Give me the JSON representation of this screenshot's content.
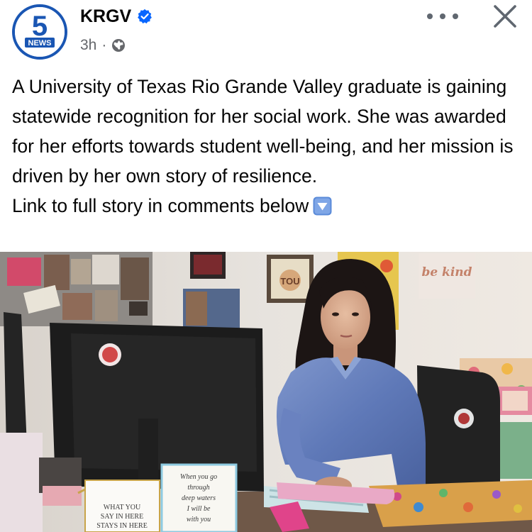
{
  "header": {
    "avatar_logo_number": "5",
    "avatar_logo_text": "NEWS",
    "page_name": "KRGV",
    "timestamp": "3h",
    "separator": "·",
    "audience_icon": "globe-icon",
    "verified_icon": "verified-badge-icon",
    "more_icon": "more-options-icon",
    "close_icon": "close-icon"
  },
  "post": {
    "text": "A University of Texas Rio Grande Valley graduate is gaining statewide recognition for her social work. She was awarded for her efforts towards student well-being, and her mission is driven by her own story of resilience.",
    "link_line": "Link to full story in comments below",
    "link_emoji": "down-arrow-button-icon"
  },
  "photo": {
    "card_left_text": [
      "WHAT YOU",
      "SAY IN HERE",
      "STAYS IN HERE"
    ],
    "card_right_text": [
      "When you go",
      "through",
      "deep waters",
      "I will be",
      "with you"
    ],
    "wall_sign_text": "be kind",
    "wall_frame_text": "TOU"
  },
  "colors": {
    "brand_blue": "#1a56b3",
    "verified_blue": "#0866ff",
    "secondary_text": "#65676b",
    "emoji_blue": "#5b8bd9"
  }
}
